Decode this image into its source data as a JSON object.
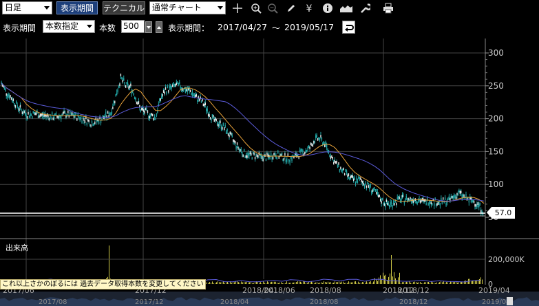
{
  "toolbar": {
    "interval_select": "日足",
    "period_button": "表示期間",
    "technical_button": "テクニカル",
    "chart_type_select": "通常チャート",
    "icons": [
      "crosshair-icon",
      "zoom-in-icon",
      "zoom-out-icon",
      "pencil-icon",
      "yen-icon",
      "info-icon",
      "chart-area-icon",
      "wrench-icon",
      "print-icon"
    ]
  },
  "period_bar": {
    "label": "表示期間",
    "mode_select": "本数指定",
    "count_label": "本数",
    "count_value": "500",
    "range_label": "表示期間：",
    "range_start": "2017/04/27",
    "range_sep": "〜",
    "range_end": "2019/05/17"
  },
  "chart_data": {
    "type": "line",
    "price_axis_ticks": [
      "300",
      "250",
      "200",
      "150",
      "100",
      "50"
    ],
    "ylim": [
      50,
      300
    ],
    "top_xaxis_labels": [
      "2017/06",
      "2017/12",
      "2018/04",
      "2018/06",
      "2018/08",
      "2018/12",
      "2018/12",
      "2019/04"
    ],
    "bottom_xaxis_labels": [
      "2017/08",
      "2017/12",
      "2018/04",
      "2018/08",
      "2018/12",
      "2019/04"
    ],
    "current_price": "57.0",
    "volume_title": "出来高",
    "volume_axis_ticks": [
      "200,000K",
      "0"
    ],
    "colors": {
      "candle": "#21a3a3",
      "ma_short": "#e8a23a",
      "ma_long": "#5a5ad8",
      "volume": "#d8d24a",
      "grid": "#444444"
    },
    "series": [
      {
        "values": [
          254,
          240,
          232,
          221,
          213,
          207,
          206,
          208,
          205,
          205,
          203,
          203,
          205,
          207,
          205,
          204,
          201,
          198,
          194,
          196,
          199,
          204,
          209,
          234,
          262,
          250,
          248,
          232,
          214,
          210,
          205,
          202,
          230,
          244,
          246,
          251,
          249,
          244,
          242,
          233,
          228,
          219,
          205,
          195,
          192,
          184,
          174,
          162,
          152,
          146,
          144,
          144,
          142,
          141,
          143,
          146,
          143,
          141,
          140,
          142,
          147,
          150,
          156,
          168,
          170,
          162,
          147,
          134,
          125,
          118,
          110,
          106,
          107,
          102,
          96,
          89,
          79,
          72,
          69,
          73,
          77,
          78,
          77,
          78,
          76,
          73,
          75,
          74,
          72,
          74,
          76,
          82,
          87,
          81,
          76,
          74,
          68,
          57
        ]
      }
    ]
  },
  "volume_notice": "これ以上さかのぼるには 過去データ取得本数を変更してください"
}
